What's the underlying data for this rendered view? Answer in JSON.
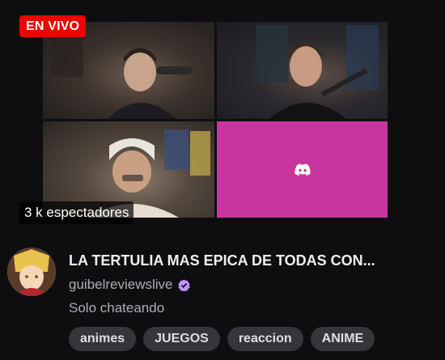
{
  "stream": {
    "live_label": "EN VIVO",
    "viewers_label": "3 k espectadores",
    "title": "LA TERTULIA MAS EPICA DE TODAS CON...",
    "channel": "guibelreviewslive",
    "category": "Solo chateando",
    "tags": [
      "animes",
      "JUEGOS",
      "reaccion",
      "ANIME"
    ]
  },
  "icons": {
    "verified": "verified-badge-icon",
    "discord": "discord-icon"
  },
  "colors": {
    "live_red": "#eb0400",
    "verified_purple": "#bf94ff",
    "discord_tile": "#c8359f"
  }
}
